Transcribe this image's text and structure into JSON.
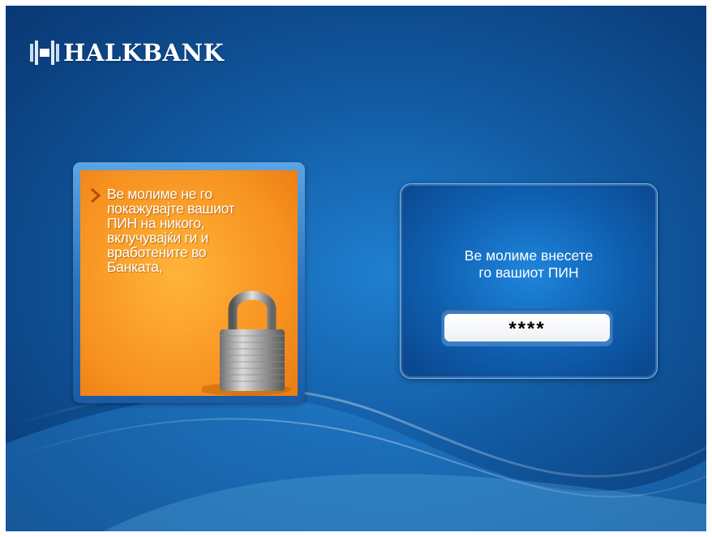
{
  "brand": {
    "name": "HALKBANK",
    "logo_icon": "halkbank-logo-icon"
  },
  "warning": {
    "icon": "chevron-right-icon",
    "text": "Ве молиме не го\nпокажувајте вашиот\nПИН на никого,\nвклучувајќи ги и\nвработените во\nБанката,",
    "illustration": "padlock-icon"
  },
  "pin_entry": {
    "prompt": "Ве молиме внесете\nго вашиот ПИН",
    "masked_value": "****"
  },
  "colors": {
    "background": "#11589f",
    "warning_card": "#f79220",
    "panel": "#0f5fb0"
  }
}
